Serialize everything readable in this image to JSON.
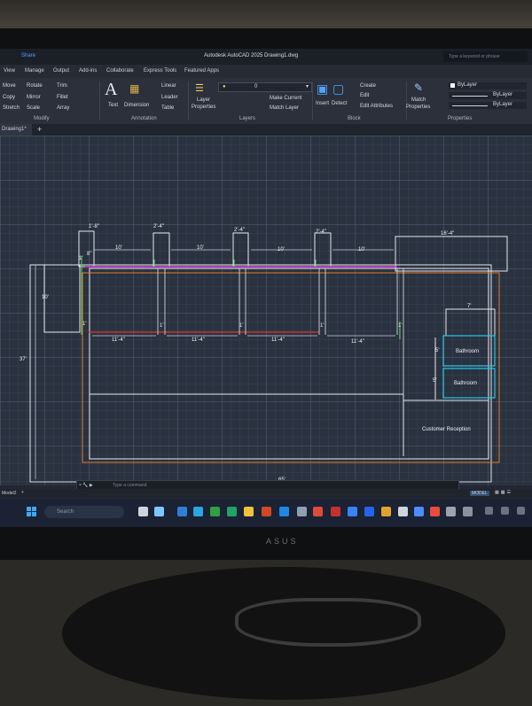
{
  "titlebar": {
    "share": "Share",
    "title": "Autodesk AutoCAD 2025   Drawing1.dwg",
    "search_placeholder": "Type a keyword or phrase"
  },
  "menu": [
    "View",
    "Manage",
    "Output",
    "Add-ins",
    "Collaborate",
    "Express Tools",
    "Featured Apps"
  ],
  "ribbon": {
    "modify": {
      "items": [
        "Move",
        "Rotate",
        "Trim",
        "Copy",
        "Mirror",
        "Fillet",
        "Stretch",
        "Scale",
        "Array"
      ],
      "title": "Modify"
    },
    "annotation": {
      "text": "Text",
      "dimension": "Dimension",
      "linear": "Linear",
      "leader": "Leader",
      "table": "Table",
      "title": "Annotation"
    },
    "layers": {
      "layer_properties_1": "Layer",
      "layer_properties_2": "Properties",
      "current_layer": "0",
      "make_current": "Make Current",
      "match_layer": "Match Layer",
      "title": "Layers"
    },
    "block": {
      "insert": "Insert",
      "detect": "Detect",
      "create": "Create",
      "edit": "Edit",
      "edit_attributes": "Edit Attributes",
      "title": "Block"
    },
    "properties": {
      "match_1": "Match",
      "match_2": "Properties",
      "bylayer": "ByLayer",
      "title": "Properties"
    }
  },
  "drawing_tab": "Drawing1*",
  "plan": {
    "dims": {
      "top_small_1": "1'-8\"",
      "top_small_2": "2'-4\"",
      "top_small_3": "2'-4\"",
      "top_small_4": "2'-4\"",
      "span_1": "10'",
      "span_2": "10'",
      "span_3": "10'",
      "span_4": "10'",
      "right_top": "16'-4\"",
      "one_a": "1'",
      "one_b": "8\"",
      "left_10": "10'",
      "left_37": "37'",
      "bay_1": "11'-4\"",
      "bay_2": "11'-4\"",
      "bay_3": "11'-4\"",
      "bay_4": "11'-4\"",
      "wall_1": "1'",
      "wall_2": "1'",
      "wall_3": "1'",
      "wall_4": "1'",
      "wall_5": "1'",
      "seven": "7'",
      "five_1": "5'",
      "five_2": "5'",
      "bottom_65": "65'"
    },
    "rooms": {
      "bathroom_1": "Bathroom",
      "bathroom_2": "Bathroom",
      "reception": "Customer Reception"
    }
  },
  "command_placeholder": "Type a command",
  "layout_tab": "Model2",
  "status": {
    "model": "MODEL"
  },
  "taskbar": {
    "search": "Search"
  },
  "brand": "ASUS",
  "colors": {
    "outline": "#e6e8ec",
    "orange": "#e07a2e",
    "magenta": "#e040e0",
    "red": "#e0322e",
    "green": "#5fd35f",
    "cyan": "#27c7e8",
    "accent": "#4fa3ff"
  }
}
